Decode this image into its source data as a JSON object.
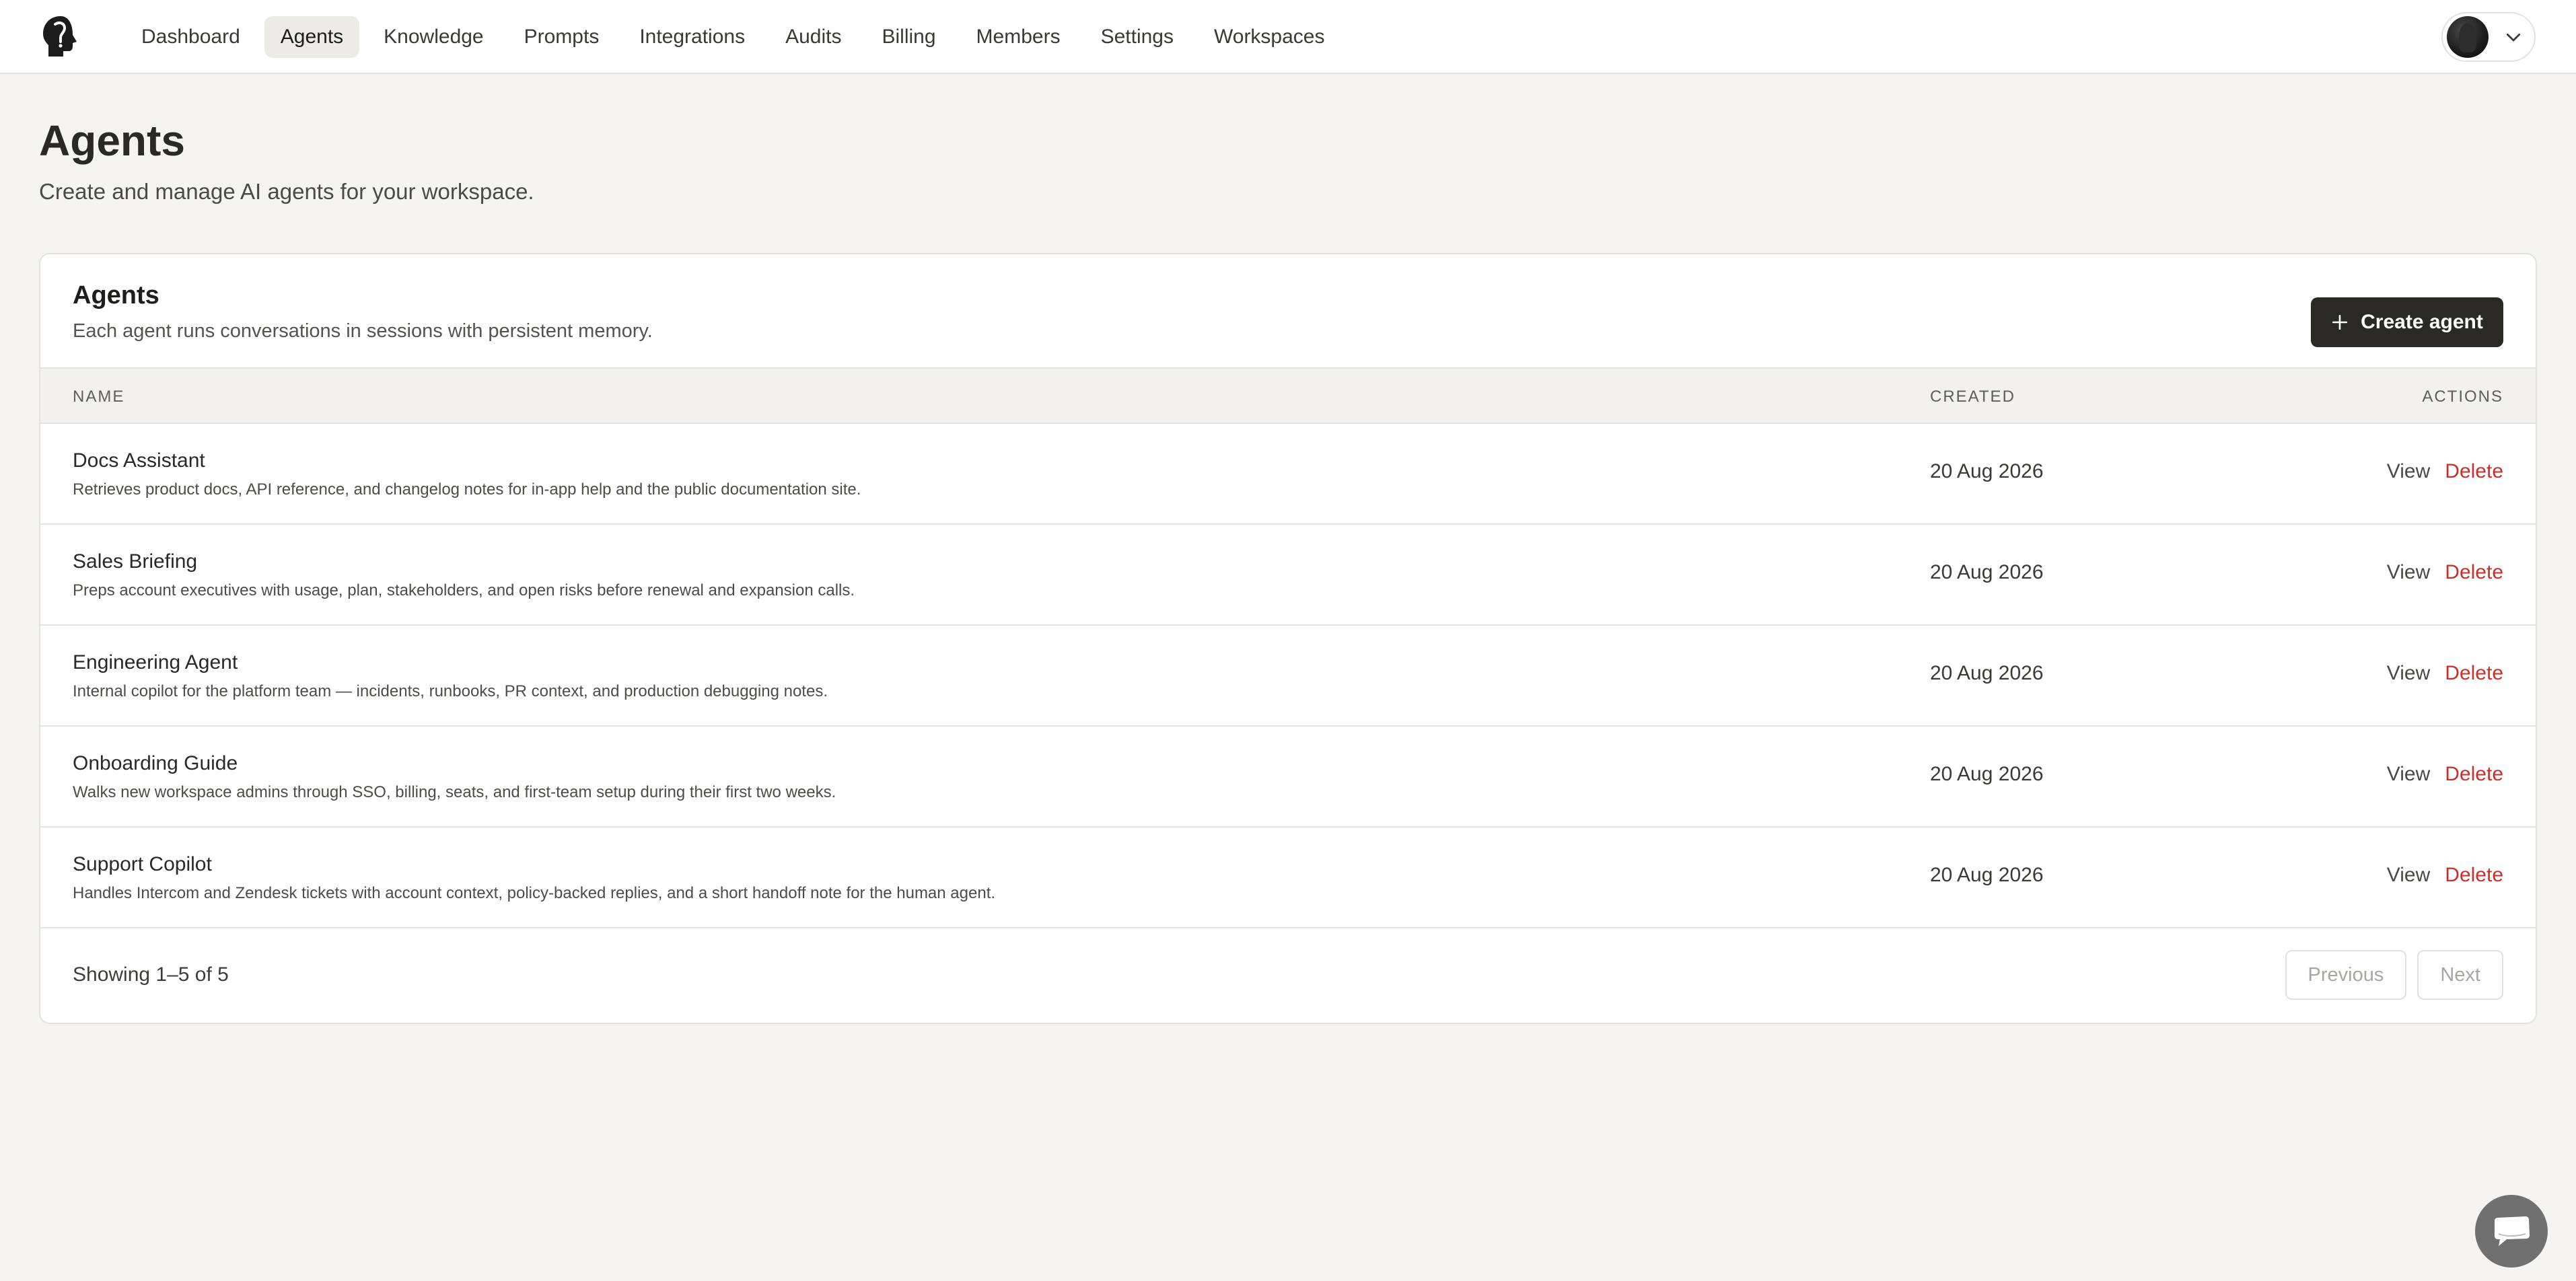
{
  "nav": {
    "items": [
      {
        "label": "Dashboard"
      },
      {
        "label": "Agents"
      },
      {
        "label": "Knowledge"
      },
      {
        "label": "Prompts"
      },
      {
        "label": "Integrations"
      },
      {
        "label": "Audits"
      },
      {
        "label": "Billing"
      },
      {
        "label": "Members"
      },
      {
        "label": "Settings"
      },
      {
        "label": "Workspaces"
      }
    ],
    "active": "Agents"
  },
  "header": {
    "title": "Agents",
    "subtitle": "Create and manage AI agents for your workspace."
  },
  "card": {
    "title": "Agents",
    "subtitle": "Each agent runs conversations in sessions with persistent memory.",
    "create_label": "Create agent",
    "columns": {
      "name": "NAME",
      "created": "CREATED",
      "actions": "ACTIONS"
    },
    "rows": [
      {
        "name": "Docs Assistant",
        "desc": "Retrieves product docs, API reference, and changelog notes for in-app help and the public documentation site.",
        "created": "20 Aug 2026",
        "view": "View",
        "delete": "Delete"
      },
      {
        "name": "Sales Briefing",
        "desc": "Preps account executives with usage, plan, stakeholders, and open risks before renewal and expansion calls.",
        "created": "20 Aug 2026",
        "view": "View",
        "delete": "Delete"
      },
      {
        "name": "Engineering Agent",
        "desc": "Internal copilot for the platform team — incidents, runbooks, PR context, and production debugging notes.",
        "created": "20 Aug 2026",
        "view": "View",
        "delete": "Delete"
      },
      {
        "name": "Onboarding Guide",
        "desc": "Walks new workspace admins through SSO, billing, seats, and first-team setup during their first two weeks.",
        "created": "20 Aug 2026",
        "view": "View",
        "delete": "Delete"
      },
      {
        "name": "Support Copilot",
        "desc": "Handles Intercom and Zendesk tickets with account context, policy-backed replies, and a short handoff note for the human agent.",
        "created": "20 Aug 2026",
        "view": "View",
        "delete": "Delete"
      }
    ],
    "showing": "Showing 1–5 of 5",
    "prev_label": "Previous",
    "next_label": "Next"
  },
  "icons": {
    "logo": "head-silhouette-logo-icon",
    "account_chevron": "chevron-down-icon",
    "create": "plus-icon",
    "chat": "chat-bubble-icon"
  },
  "colors": {
    "accent_dark": "#2a2926",
    "danger": "#c9302c",
    "background": "#f5f4f2"
  }
}
